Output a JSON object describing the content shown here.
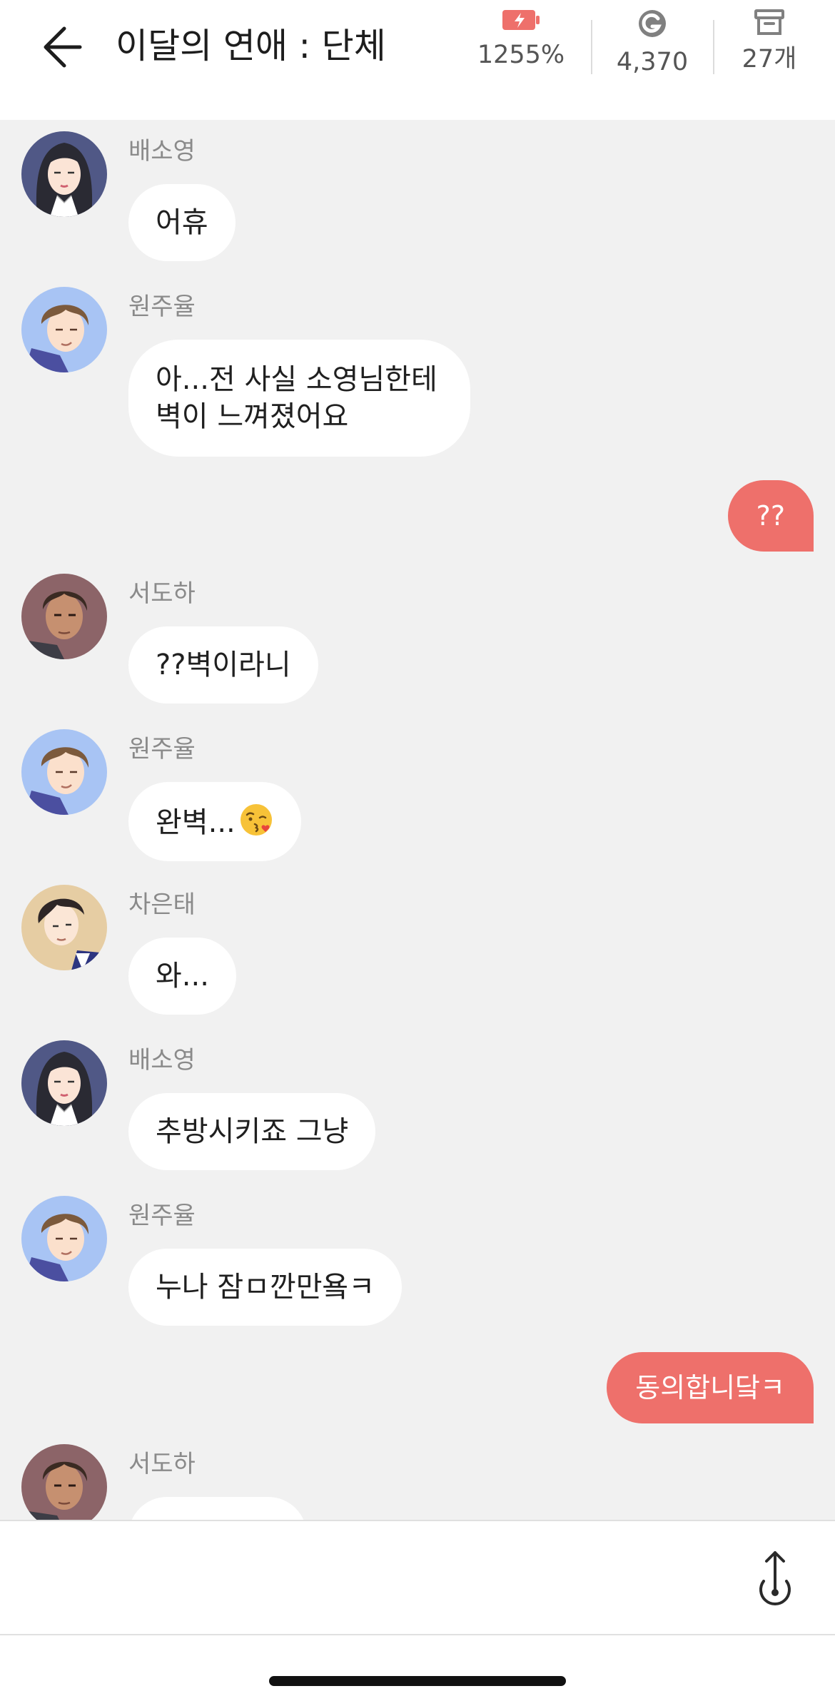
{
  "header": {
    "title": "이달의 연애 : 단체",
    "stats": {
      "energy": "1255%",
      "gold": "4,370",
      "box": "27개"
    },
    "icons": {
      "back": "back-arrow-icon",
      "energy": "battery-charge-icon",
      "gold": "gold-coin-icon",
      "box": "archive-box-icon"
    },
    "accent_color": "#ee706b"
  },
  "messages": [
    {
      "type": "in",
      "sender": "배소영",
      "text": "어휴"
    },
    {
      "type": "in",
      "sender": "원주율",
      "lines": [
        "아...전 사실 소영님한테",
        "벽이 느껴졌어요"
      ]
    },
    {
      "type": "out",
      "text": "??"
    },
    {
      "type": "in",
      "sender": "서도하",
      "text": "??벽이라니"
    },
    {
      "type": "in",
      "sender": "원주율",
      "text": "완벽...",
      "emoji": "kissing-face-emoji"
    },
    {
      "type": "in",
      "sender": "차은태",
      "text": "와..."
    },
    {
      "type": "in",
      "sender": "배소영",
      "text": "추방시키죠 그냥"
    },
    {
      "type": "in",
      "sender": "원주율",
      "text": "누나 잠ㅁ깐만욬ㅋ"
    },
    {
      "type": "out",
      "text": "동의합니닼ㅋ"
    },
    {
      "type": "in",
      "sender": "서도하",
      "text": ""
    }
  ],
  "input": {
    "send_icon": "send-upload-icon"
  },
  "colors": {
    "chat_background": "#f1f1f1",
    "incoming_bubble": "#ffffff",
    "outgoing_bubble": "#ee706b"
  }
}
